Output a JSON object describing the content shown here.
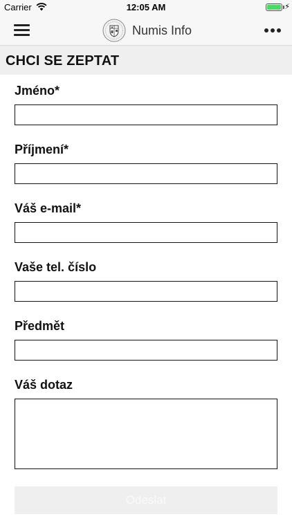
{
  "status_bar": {
    "carrier": "Carrier",
    "time": "12:05 AM",
    "battery_level": 1.0,
    "battery_color": "#4cd964"
  },
  "nav": {
    "title": "Numis Info",
    "left_icon": "hamburger-menu-icon",
    "logo_icon": "coat-of-arms-logo-icon",
    "right_icon": "more-ellipsis-icon"
  },
  "section": {
    "title": "CHCI SE ZEPTAT"
  },
  "form": {
    "fields": [
      {
        "label": "Jméno*",
        "value": "",
        "placeholder": ""
      },
      {
        "label": "Příjmení*",
        "value": "",
        "placeholder": ""
      },
      {
        "label": "Váš e-mail*",
        "value": "",
        "placeholder": ""
      },
      {
        "label": "Vaše tel. číslo",
        "value": "",
        "placeholder": ""
      },
      {
        "label": "Předmět",
        "value": "",
        "placeholder": ""
      },
      {
        "label": "Váš dotaz",
        "value": "",
        "placeholder": ""
      }
    ],
    "submit_label": "Odeslat"
  }
}
